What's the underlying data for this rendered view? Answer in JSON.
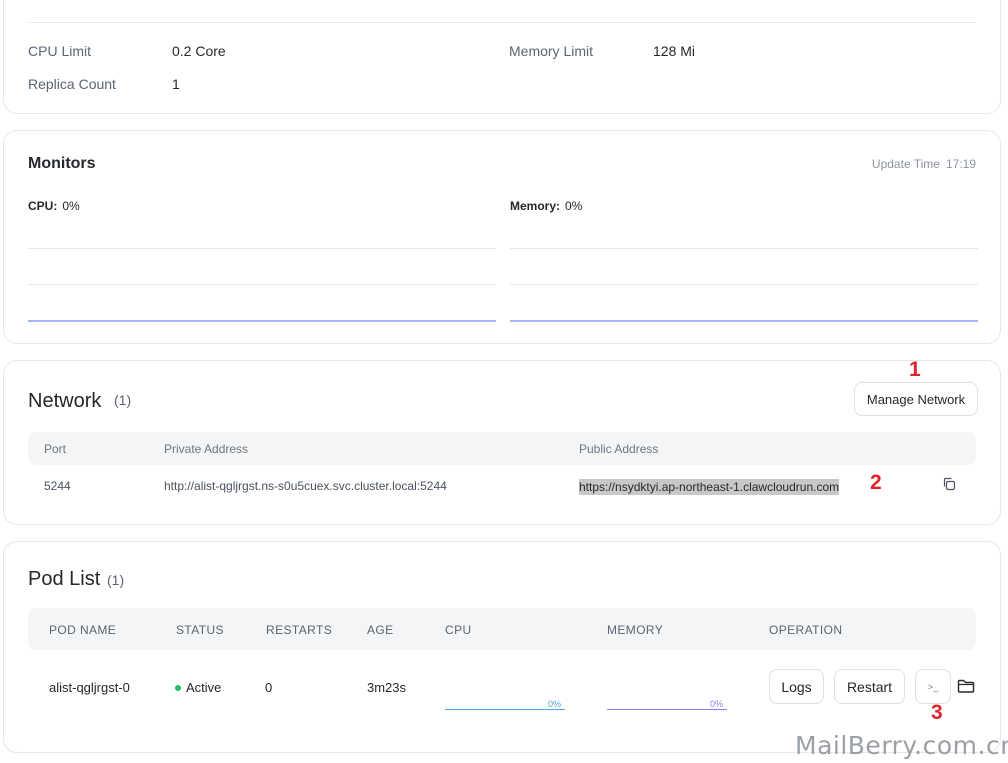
{
  "resource": {
    "cpu_limit_label": "CPU Limit",
    "cpu_limit_value": "0.2 Core",
    "memory_limit_label": "Memory Limit",
    "memory_limit_value": "128 Mi",
    "replica_label": "Replica Count",
    "replica_value": "1"
  },
  "monitors": {
    "title": "Monitors",
    "update_time_label": "Update Time",
    "update_time_value": "17:19",
    "cpu_label": "CPU:",
    "cpu_value": "0%",
    "memory_label": "Memory:",
    "memory_value": "0%"
  },
  "network": {
    "title": "Network",
    "count": "(1)",
    "manage_button": "Manage Network",
    "columns": [
      "Port",
      "Private Address",
      "Public Address"
    ],
    "rows": [
      {
        "port": "5244",
        "private_address": "http://alist-qgljrgst.ns-s0u5cuex.svc.cluster.local:5244",
        "public_address": "https://nsydktyi.ap-northeast-1.clawcloudrun.com"
      }
    ]
  },
  "pods": {
    "title": "Pod List",
    "count": "(1)",
    "columns": [
      "POD NAME",
      "STATUS",
      "RESTARTS",
      "AGE",
      "CPU",
      "MEMORY",
      "OPERATION"
    ],
    "rows": [
      {
        "name": "alist-qgljrgst-0",
        "status": "Active",
        "restarts": "0",
        "age": "3m23s",
        "cpu_pct": "0%",
        "memory_pct": "0%"
      }
    ],
    "logs_button": "Logs",
    "restart_button": "Restart",
    "terminal_glyph": ">_"
  },
  "markers": {
    "m1": "1",
    "m2": "2",
    "m3": "3"
  },
  "icons": {
    "copy": "copy-icon",
    "terminal": "terminal-icon",
    "folder": "folder-icon"
  },
  "colors": {
    "status_active": "#1fbf6b",
    "cpu_line": "#4da3e0",
    "memory_line": "#8b7cf0",
    "chart_baseline": "#a9b4f5",
    "marker": "#e0242a"
  },
  "watermark": "MailBerry.com.cn"
}
